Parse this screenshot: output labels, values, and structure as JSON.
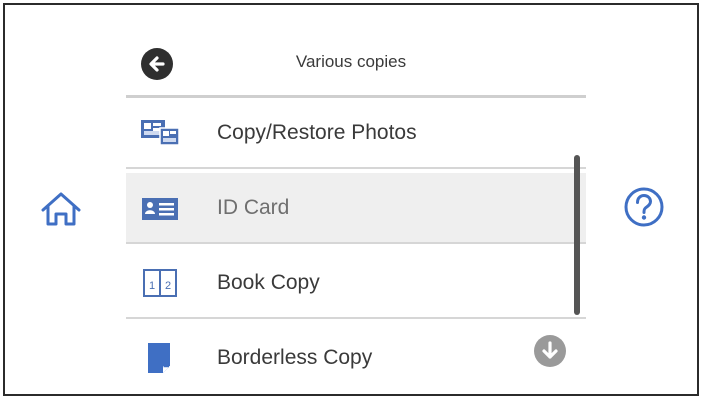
{
  "header": {
    "title": "Various copies"
  },
  "menu": {
    "items": [
      {
        "label": "Copy/Restore Photos",
        "icon": "photo-restore-icon"
      },
      {
        "label": "ID Card",
        "icon": "id-card-icon"
      },
      {
        "label": "Book Copy",
        "icon": "book-copy-icon",
        "page_numbers": [
          "1",
          "2"
        ]
      },
      {
        "label": "Borderless Copy",
        "icon": "borderless-copy-icon"
      }
    ],
    "selected_label": "ID Card"
  },
  "colors": {
    "accent": "#3f6fc4",
    "icon_fill": "#4a6fb3",
    "selected_row": "#efefef",
    "text": "#3a3a3a"
  }
}
